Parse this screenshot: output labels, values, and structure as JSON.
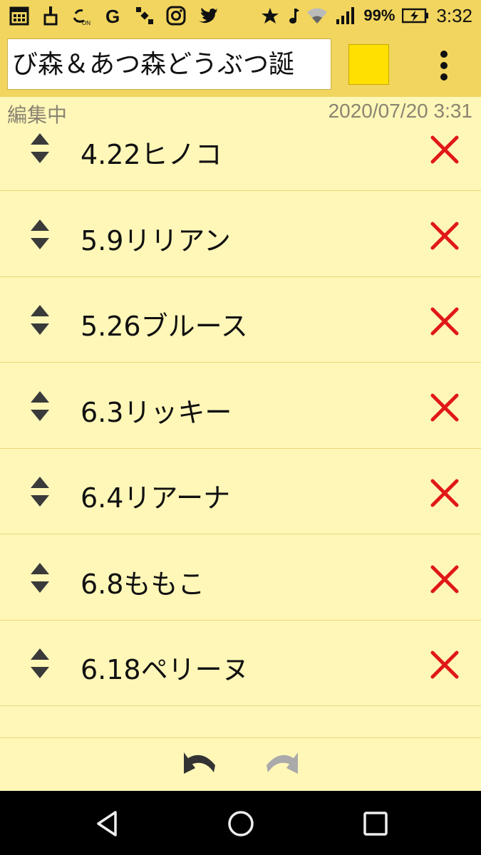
{
  "status_bar": {
    "battery": "99%",
    "time": "3:32",
    "icons_left": [
      "calendar-icon",
      "broom-icon",
      "nfc-icon",
      "google-icon",
      "satellite-icon",
      "instagram-icon",
      "twitter-icon"
    ],
    "icons_right": [
      "star-icon",
      "music-note-icon",
      "wifi-icon",
      "signal-icon",
      "battery-charging-icon"
    ]
  },
  "app_bar": {
    "title_value": "び森＆あつ森どうぶつ",
    "title_cutoff_char": "誕",
    "swatch_color": "#ffe000"
  },
  "meta": {
    "editing_label": "編集中",
    "timestamp": "2020/07/20 3:31"
  },
  "items": [
    {
      "text": "4.22ヒノコ"
    },
    {
      "text": "5.9リリアン"
    },
    {
      "text": "5.26ブルース"
    },
    {
      "text": "6.3リッキー"
    },
    {
      "text": "6.4リアーナ"
    },
    {
      "text": "6.8ももこ"
    },
    {
      "text": "6.18ペリーヌ"
    }
  ],
  "colors": {
    "bar": "#f1d55f",
    "background": "#fff7b8",
    "delete": "#e01818",
    "handle": "#333333"
  }
}
